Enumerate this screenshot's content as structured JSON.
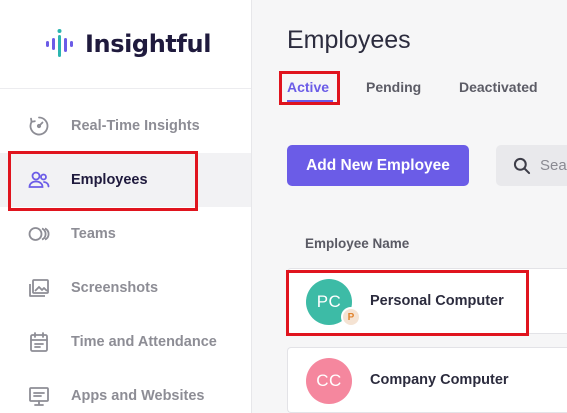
{
  "brand": {
    "name": "Insightful"
  },
  "sidebar": {
    "items": [
      {
        "label": "Real-Time Insights",
        "icon": "realtime-insights-icon"
      },
      {
        "label": "Employees",
        "icon": "employees-icon",
        "active": true
      },
      {
        "label": "Teams",
        "icon": "teams-icon"
      },
      {
        "label": "Screenshots",
        "icon": "screenshots-icon"
      },
      {
        "label": "Time and Attendance",
        "icon": "time-attendance-icon"
      },
      {
        "label": "Apps and Websites",
        "icon": "apps-websites-icon"
      }
    ]
  },
  "main": {
    "title": "Employees",
    "tabs": [
      {
        "label": "Active",
        "active": true
      },
      {
        "label": "Pending"
      },
      {
        "label": "Deactivated"
      }
    ],
    "add_button": "Add New Employee",
    "search": {
      "placeholder": "Sea"
    },
    "table": {
      "header": "Employee Name",
      "rows": [
        {
          "initials": "PC",
          "name": "Personal Computer",
          "badge": "P",
          "avatar_color": "#3dbba6"
        },
        {
          "initials": "CC",
          "name": "Company Computer",
          "avatar_color": "#f5879e"
        }
      ]
    }
  },
  "colors": {
    "accent": "#6b5ce7",
    "highlight": "#e0141e"
  }
}
